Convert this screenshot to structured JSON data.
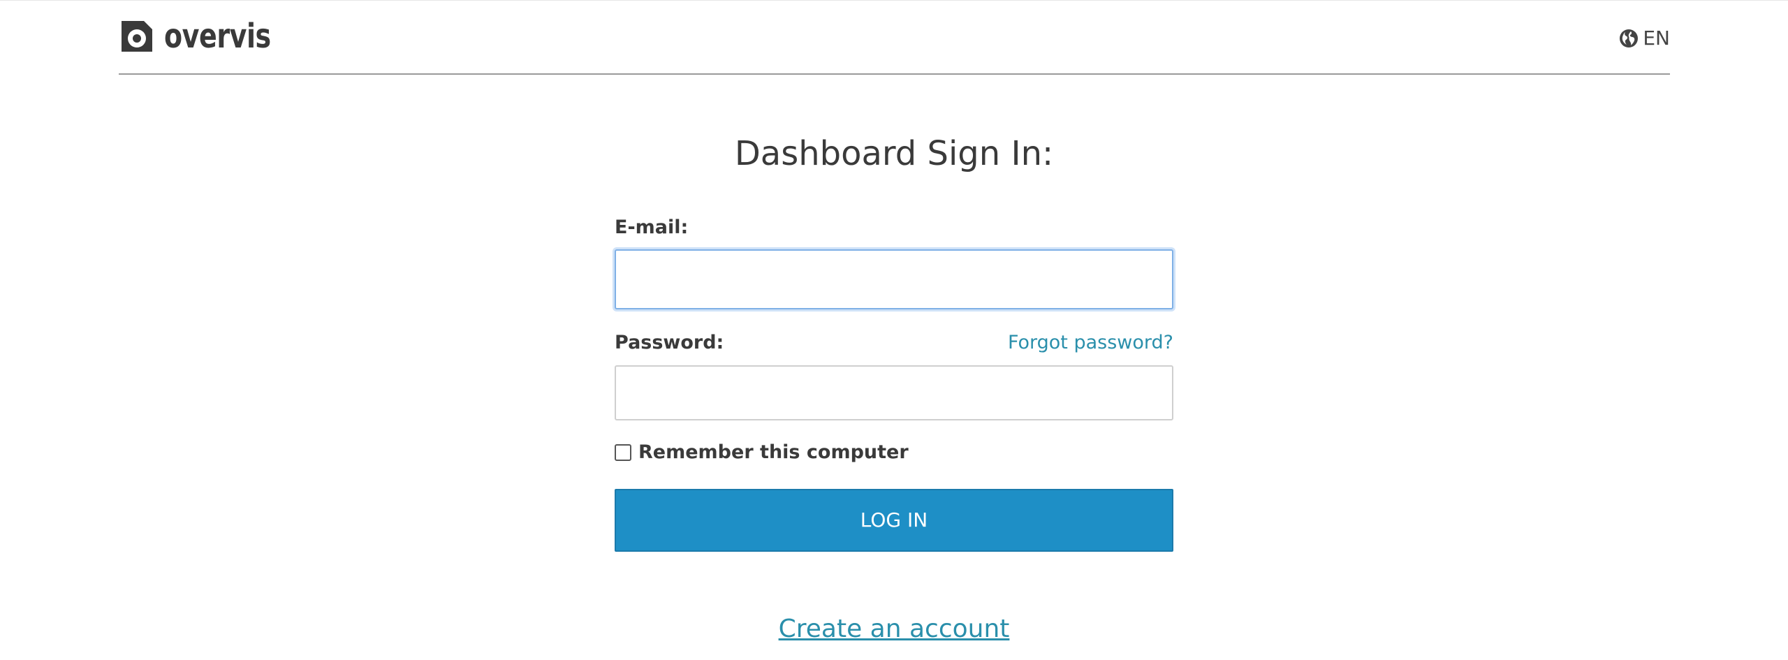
{
  "header": {
    "brand": "overvis",
    "language": "EN"
  },
  "login": {
    "title": "Dashboard Sign In:",
    "email_label": "E-mail:",
    "email_value": "",
    "password_label": "Password:",
    "password_value": "",
    "forgot_link": "Forgot password?",
    "remember_label": "Remember this computer",
    "remember_checked": false,
    "submit_label": "LOG IN",
    "create_account": "Create an account"
  },
  "colors": {
    "accent": "#1e8fc6",
    "link": "#2a8fab",
    "text": "#3a3a3a"
  },
  "icons": {
    "logo": "overvis-logo-icon",
    "language": "globe-icon"
  }
}
